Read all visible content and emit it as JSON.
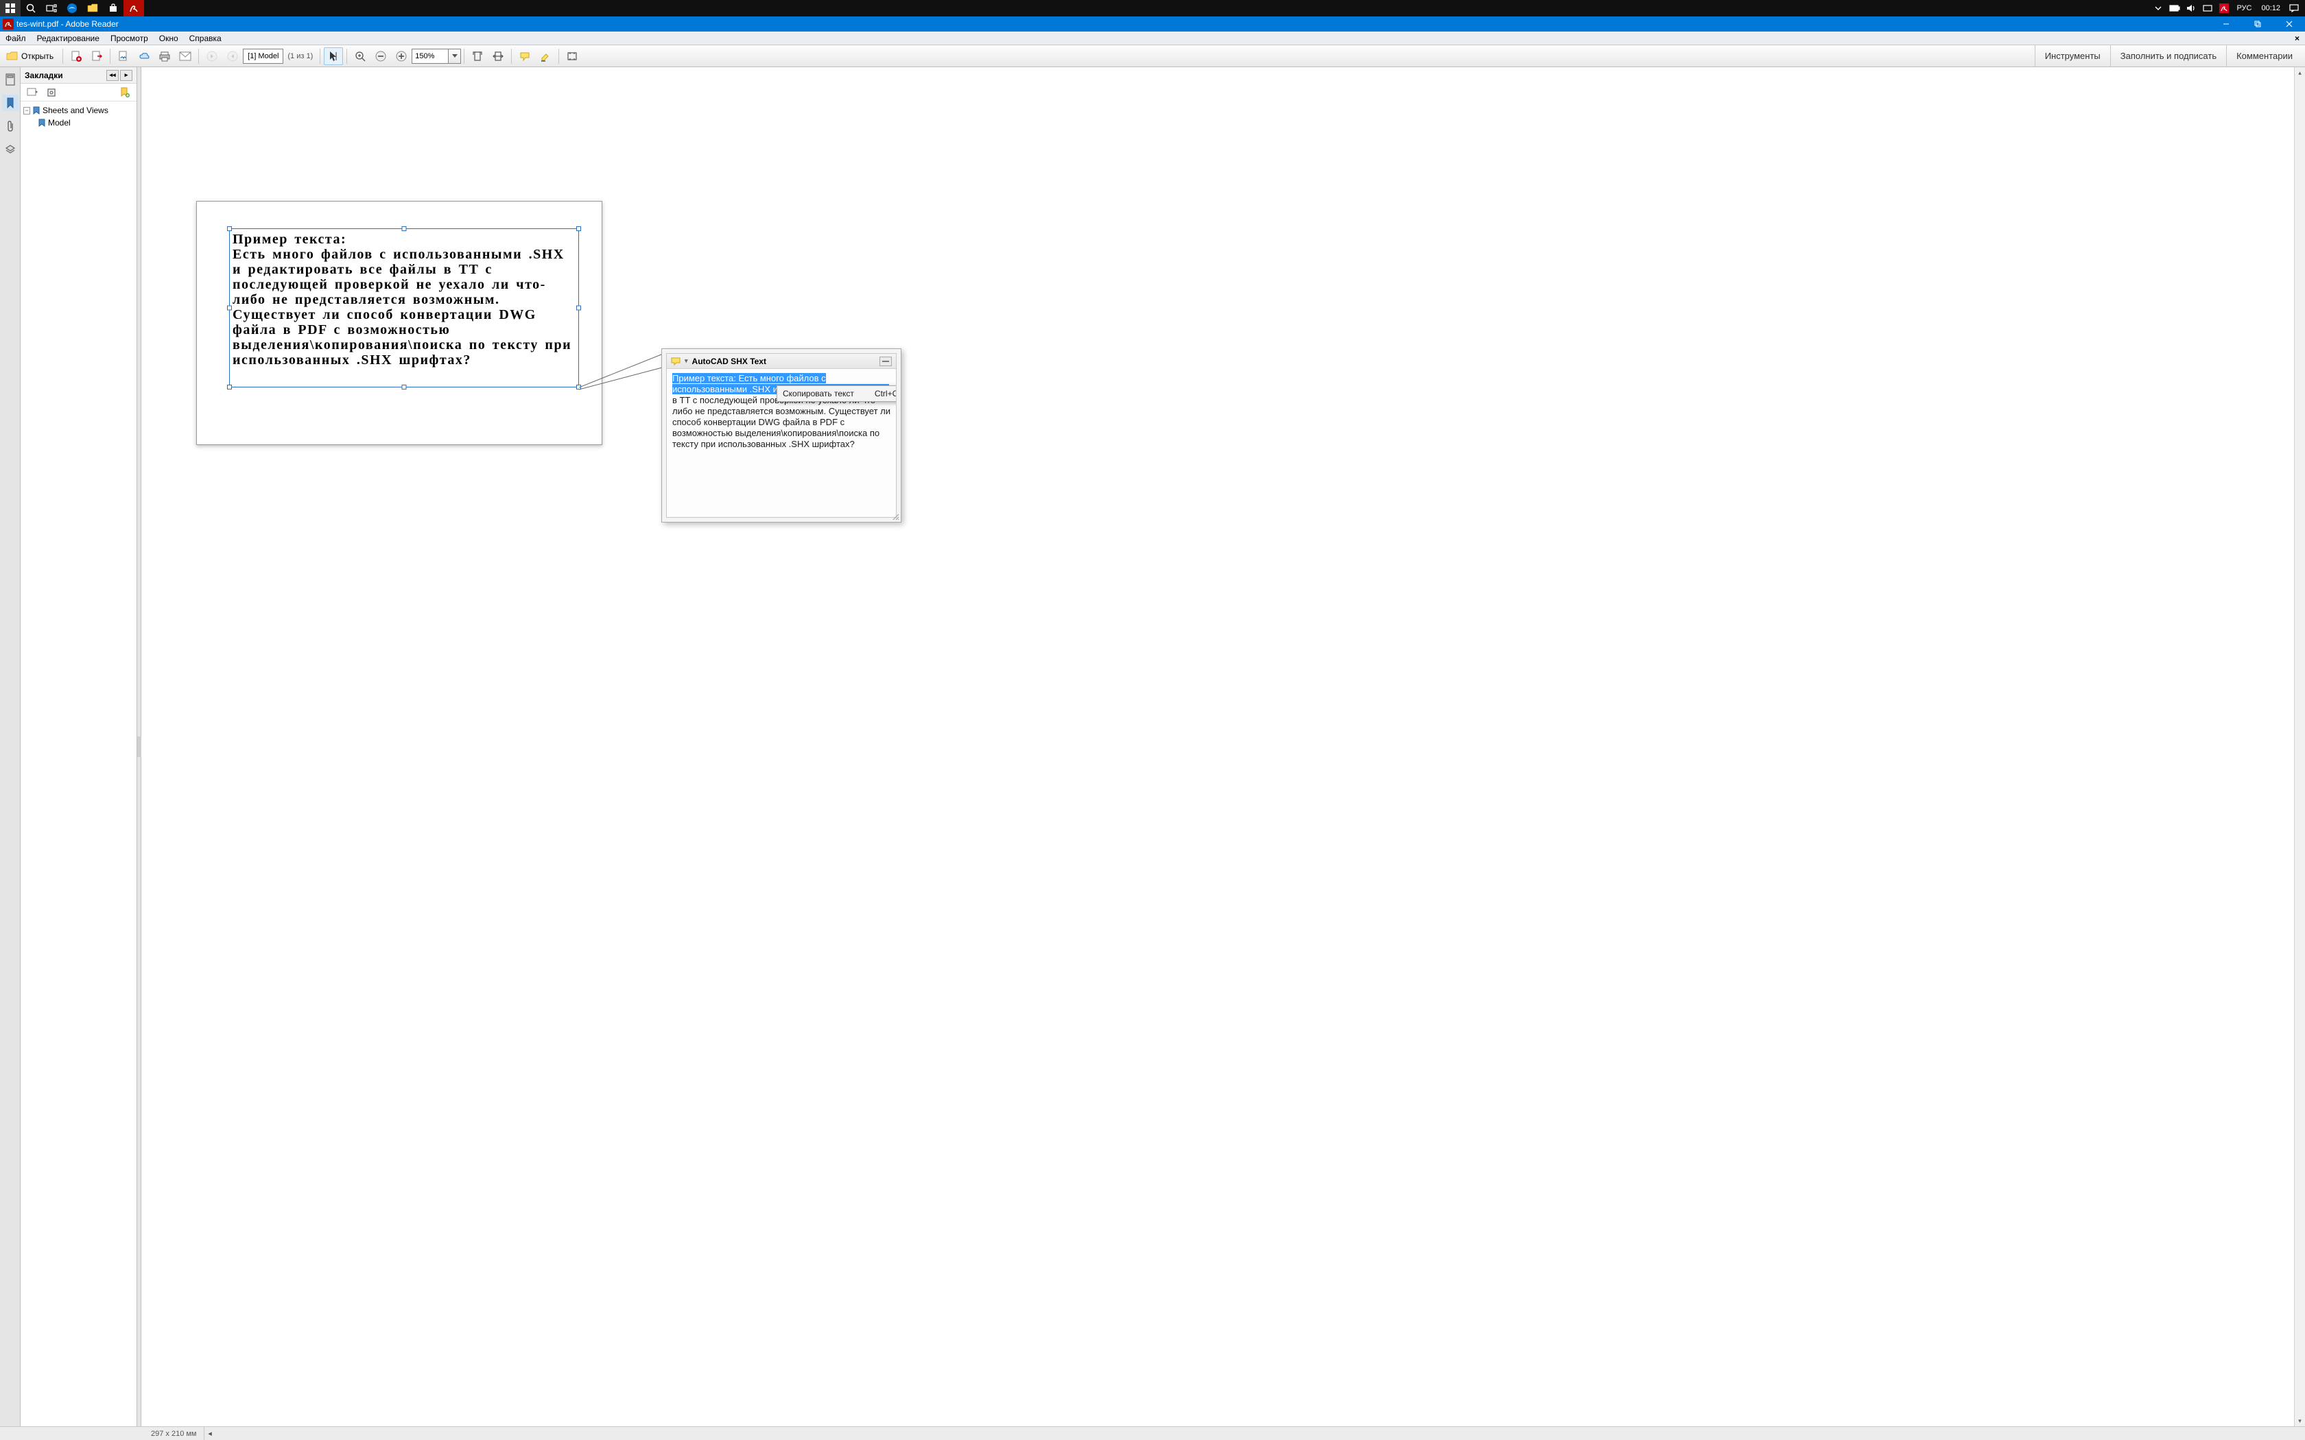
{
  "taskbar": {
    "lang": "РУС",
    "clock": "00:12"
  },
  "titlebar": {
    "title": "tes-wint.pdf - Adobe Reader"
  },
  "menubar": {
    "items": [
      "Файл",
      "Редактирование",
      "Просмотр",
      "Окно",
      "Справка"
    ]
  },
  "toolbar": {
    "open_label": "Открыть",
    "page_label": "[1] Model",
    "page_count": "(1 из 1)",
    "zoom": "150%",
    "side": {
      "tools": "Инструменты",
      "fillsign": "Заполнить и подписать",
      "comments": "Комментарии"
    }
  },
  "bookmarks": {
    "title": "Закладки",
    "tree": [
      {
        "label": "Sheets and Views",
        "expanded": true,
        "children": [
          {
            "label": "Model"
          }
        ]
      }
    ]
  },
  "document": {
    "text": "Пример текста:\nЕсть много файлов с использованными .SHX и редактировать все файлы в TT с последующей проверкой не уехало ли что-либо не представляется возможным. Существует ли способ конвертации DWG файла в PDF с возможностью выделения\\копирования\\поиска по тексту при использованных .SHX шрифтах?"
  },
  "popup": {
    "title": "AutoCAD SHX Text",
    "body_sel": "Пример текста: Есть много файлов с использованными .SHX и редактировать все файлы",
    "body_rest": " в TT с последующей проверкой не уехало ли что-либо не представляется возможным. Существует ли способ конвертации DWG файла в PDF с возможностью выделения\\копирования\\поиска по тексту при использованных .SHX шрифтах?",
    "contextmenu": {
      "copy_label": "Скопировать текст",
      "copy_shortcut": "Ctrl+C"
    }
  },
  "statusbar": {
    "dimensions": "297 x 210 мм"
  }
}
